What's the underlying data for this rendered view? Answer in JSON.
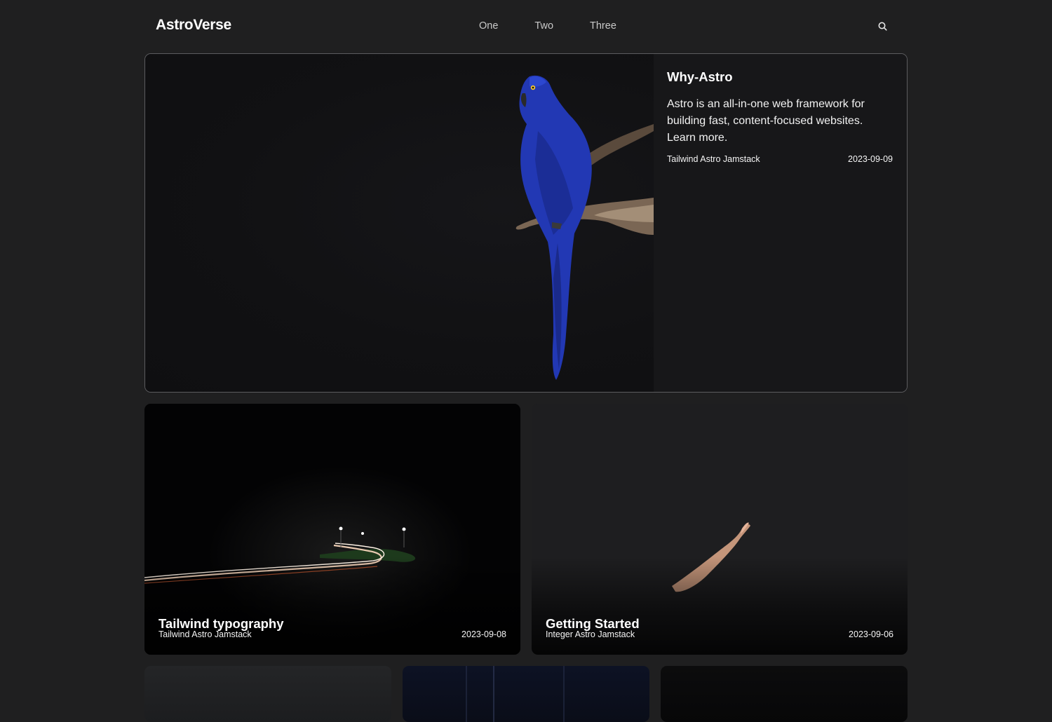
{
  "header": {
    "logo": "AstroVerse",
    "nav": [
      "One",
      "Two",
      "Three"
    ],
    "search_icon": "search-icon"
  },
  "featured": {
    "title": "Why-Astro",
    "description": "Astro is an all-in-one web framework for building fast, content-focused websites. Learn more.",
    "tags": "Tailwind Astro Jamstack",
    "date": "2023-09-09",
    "image": "blue-parrot-on-branch"
  },
  "posts": [
    {
      "title": "Tailwind typography",
      "tags": "Tailwind Astro Jamstack",
      "date": "2023-09-08",
      "image": "night-road-light-trails"
    },
    {
      "title": "Getting Started",
      "tags": "Integer Astro Jamstack",
      "date": "2023-09-06",
      "image": "hand-in-light"
    }
  ],
  "colors": {
    "background": "#1f1f20",
    "card_border": "#5c5c5f",
    "parrot_blue": "#2a3fbf",
    "text": "#ffffff",
    "nav_text": "#c9c9c9"
  }
}
